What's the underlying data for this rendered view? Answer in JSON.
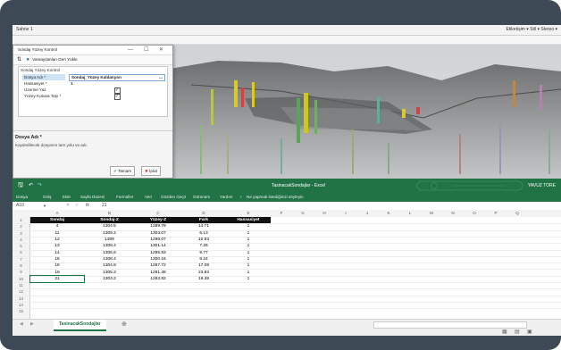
{
  "app3d": {
    "title_left": "Sahne 1",
    "title_right": "Etiketişim ▾  Stil ▾  Stereo ▾"
  },
  "dialog": {
    "title": "Sondaj Yüzey Kontrol",
    "controls": [
      "—",
      "☐",
      "✕"
    ],
    "toolbar_label": "Varsayılanları Geri Yükle",
    "grid_header": "Sondaj Yüzey Kontrol",
    "properties": [
      {
        "key": "Dosya Adı *",
        "value": "Sondaj_Yüzey Kaldanyon",
        "selected": true
      },
      {
        "key": "Hassasiyet *",
        "value": "1",
        "selected": false
      },
      {
        "key": "Üzerine Yaz",
        "value": "✓",
        "selected": false,
        "checkbox": true
      },
      {
        "key": "Yüzey Kotuna Taşı *",
        "value": "✓",
        "selected": false,
        "checkbox": true
      }
    ],
    "ellipsis": "...",
    "desc_title": "Dosya Adı *",
    "desc_text": "Kaydedilecek dosyanın tam yolu ve adı.",
    "ok_label": "Tamam",
    "cancel_label": "İptal"
  },
  "excel": {
    "window_title": "TasinacakSondajlar - Excel",
    "user": "YAVUZ TORE",
    "ribbon": [
      "Dosya",
      "Giriş",
      "Ekle",
      "Sayfa Düzeni",
      "Formüller",
      "Veri",
      "Gözden Geçir",
      "Görünüm",
      "Yardım",
      "Ne yapmak istediğinizi söyleyin"
    ],
    "namebox": "A10",
    "formula_value": "21",
    "columns": [
      "A",
      "B",
      "C",
      "D",
      "E",
      "F",
      "G",
      "H",
      "I",
      "J",
      "K",
      "L",
      "M",
      "N",
      "O",
      "P",
      "Q"
    ],
    "row_numbers": [
      "1",
      "2",
      "3",
      "4",
      "5",
      "6",
      "7",
      "8",
      "9",
      "10",
      "11",
      "12",
      "13",
      "14",
      "15"
    ],
    "table_headers": [
      "Sondaj",
      "Sondaj-Z",
      "Yüzey-Z",
      "Fark",
      "Hassasiyet"
    ],
    "rows": [
      [
        "4",
        "1304.5",
        "1289.79",
        "14.71",
        "1"
      ],
      [
        "11",
        "1309.2",
        "1303.07",
        "6.13",
        "1"
      ],
      [
        "12",
        "1309",
        "1298.07",
        "10.93",
        "1"
      ],
      [
        "13",
        "1308.4",
        "1301.14",
        "7.26",
        "1"
      ],
      [
        "14",
        "1305.6",
        "1295.83",
        "9.77",
        "1"
      ],
      [
        "16",
        "1308.4",
        "1300.16",
        "8.24",
        "1"
      ],
      [
        "18",
        "1304.8",
        "1287.72",
        "17.08",
        "1"
      ],
      [
        "19",
        "1305.3",
        "1281.48",
        "23.82",
        "1"
      ],
      [
        "21",
        "1303.2",
        "1283.82",
        "19.38",
        "1"
      ]
    ],
    "sheet_tab": "TasinacakSondajlar",
    "add_sheet": "⊕"
  }
}
